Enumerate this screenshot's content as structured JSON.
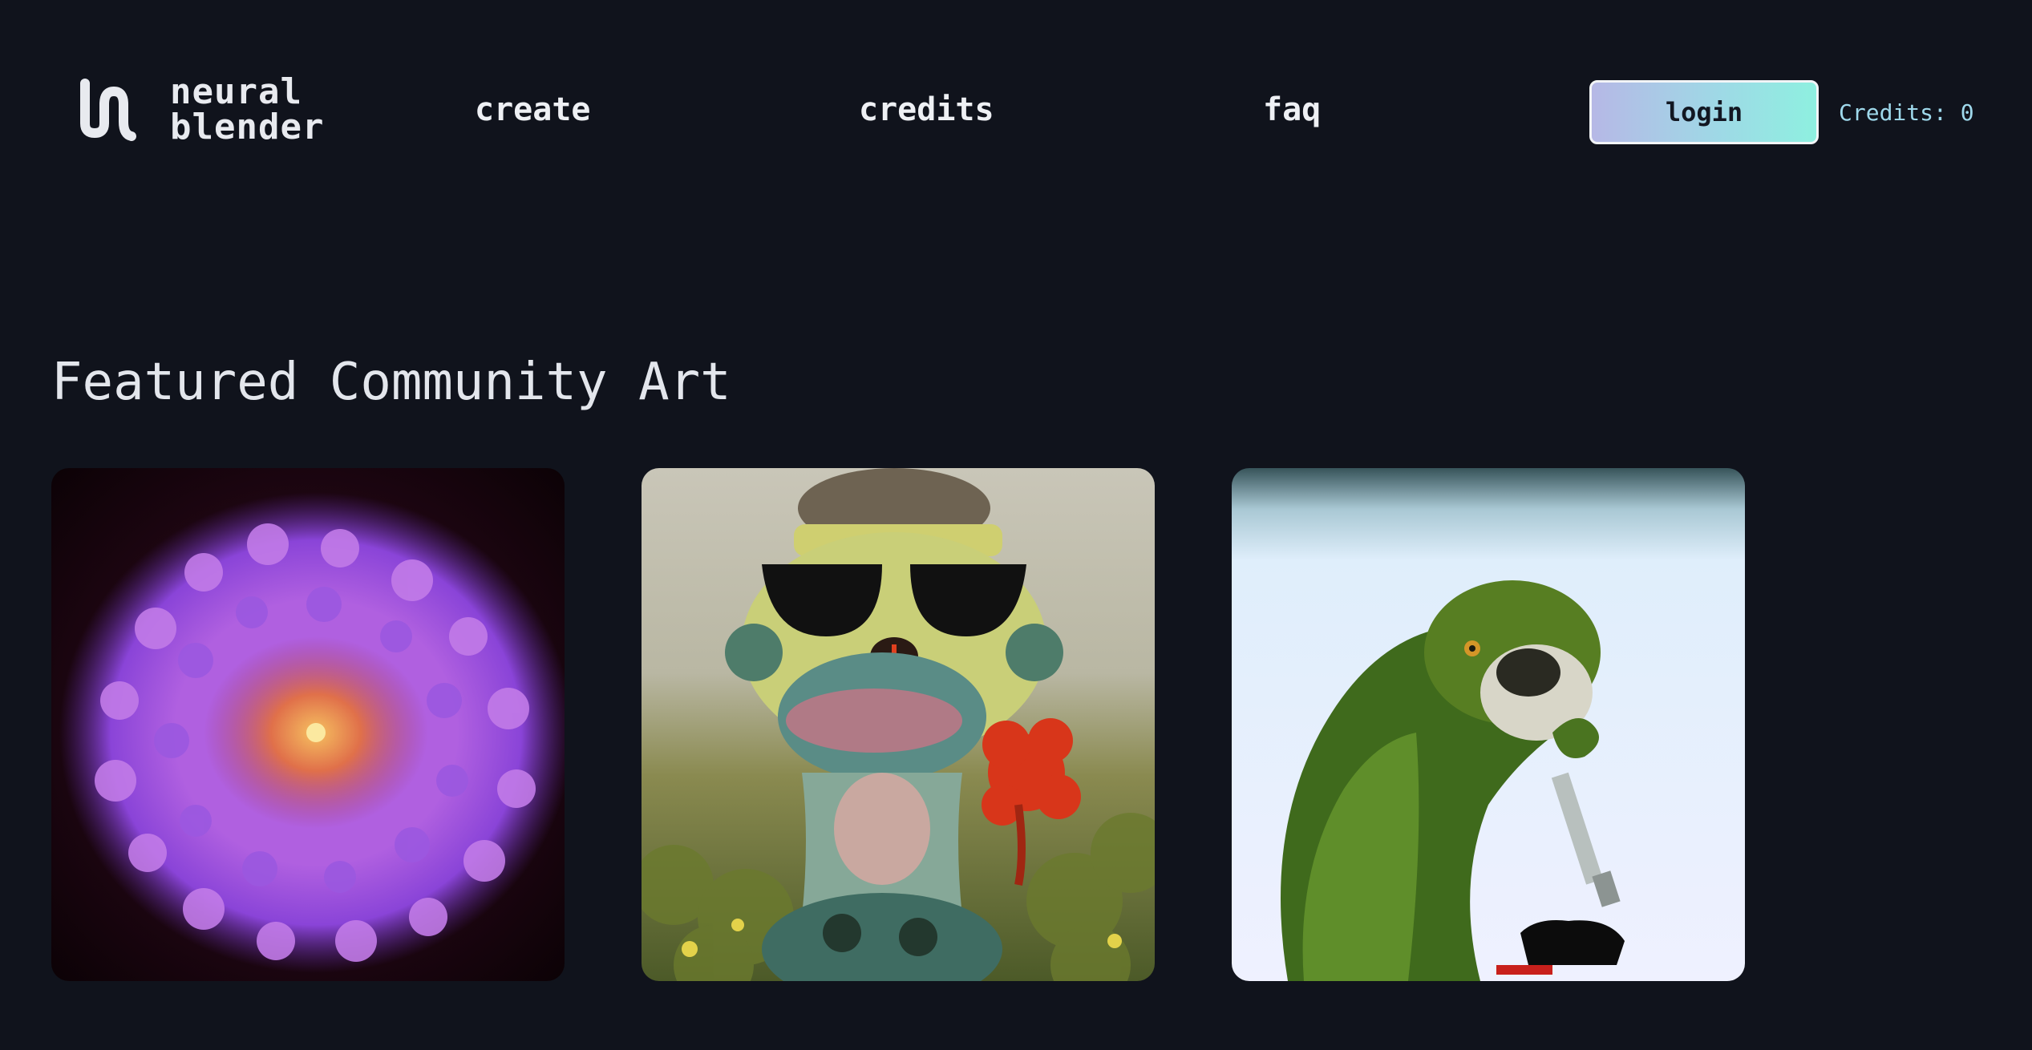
{
  "brand": {
    "line1": "neural",
    "line2": "blender",
    "icon": "nb-logo-icon"
  },
  "nav": {
    "create": "create",
    "credits": "credits",
    "faq": "faq"
  },
  "account": {
    "login_label": "login",
    "credits_text": "Credits: 0"
  },
  "featured": {
    "title": "Featured Community Art",
    "images": [
      {
        "name": "purple-anemone-artwork"
      },
      {
        "name": "sunglasses-figure-with-red-flower-artwork"
      },
      {
        "name": "green-monkey-with-razor-artwork"
      }
    ]
  },
  "colors": {
    "background": "#10131c",
    "accent_text": "#9fd9ec",
    "login_gradient_start": "#b6b8e6",
    "login_gradient_end": "#8ef0e0"
  }
}
